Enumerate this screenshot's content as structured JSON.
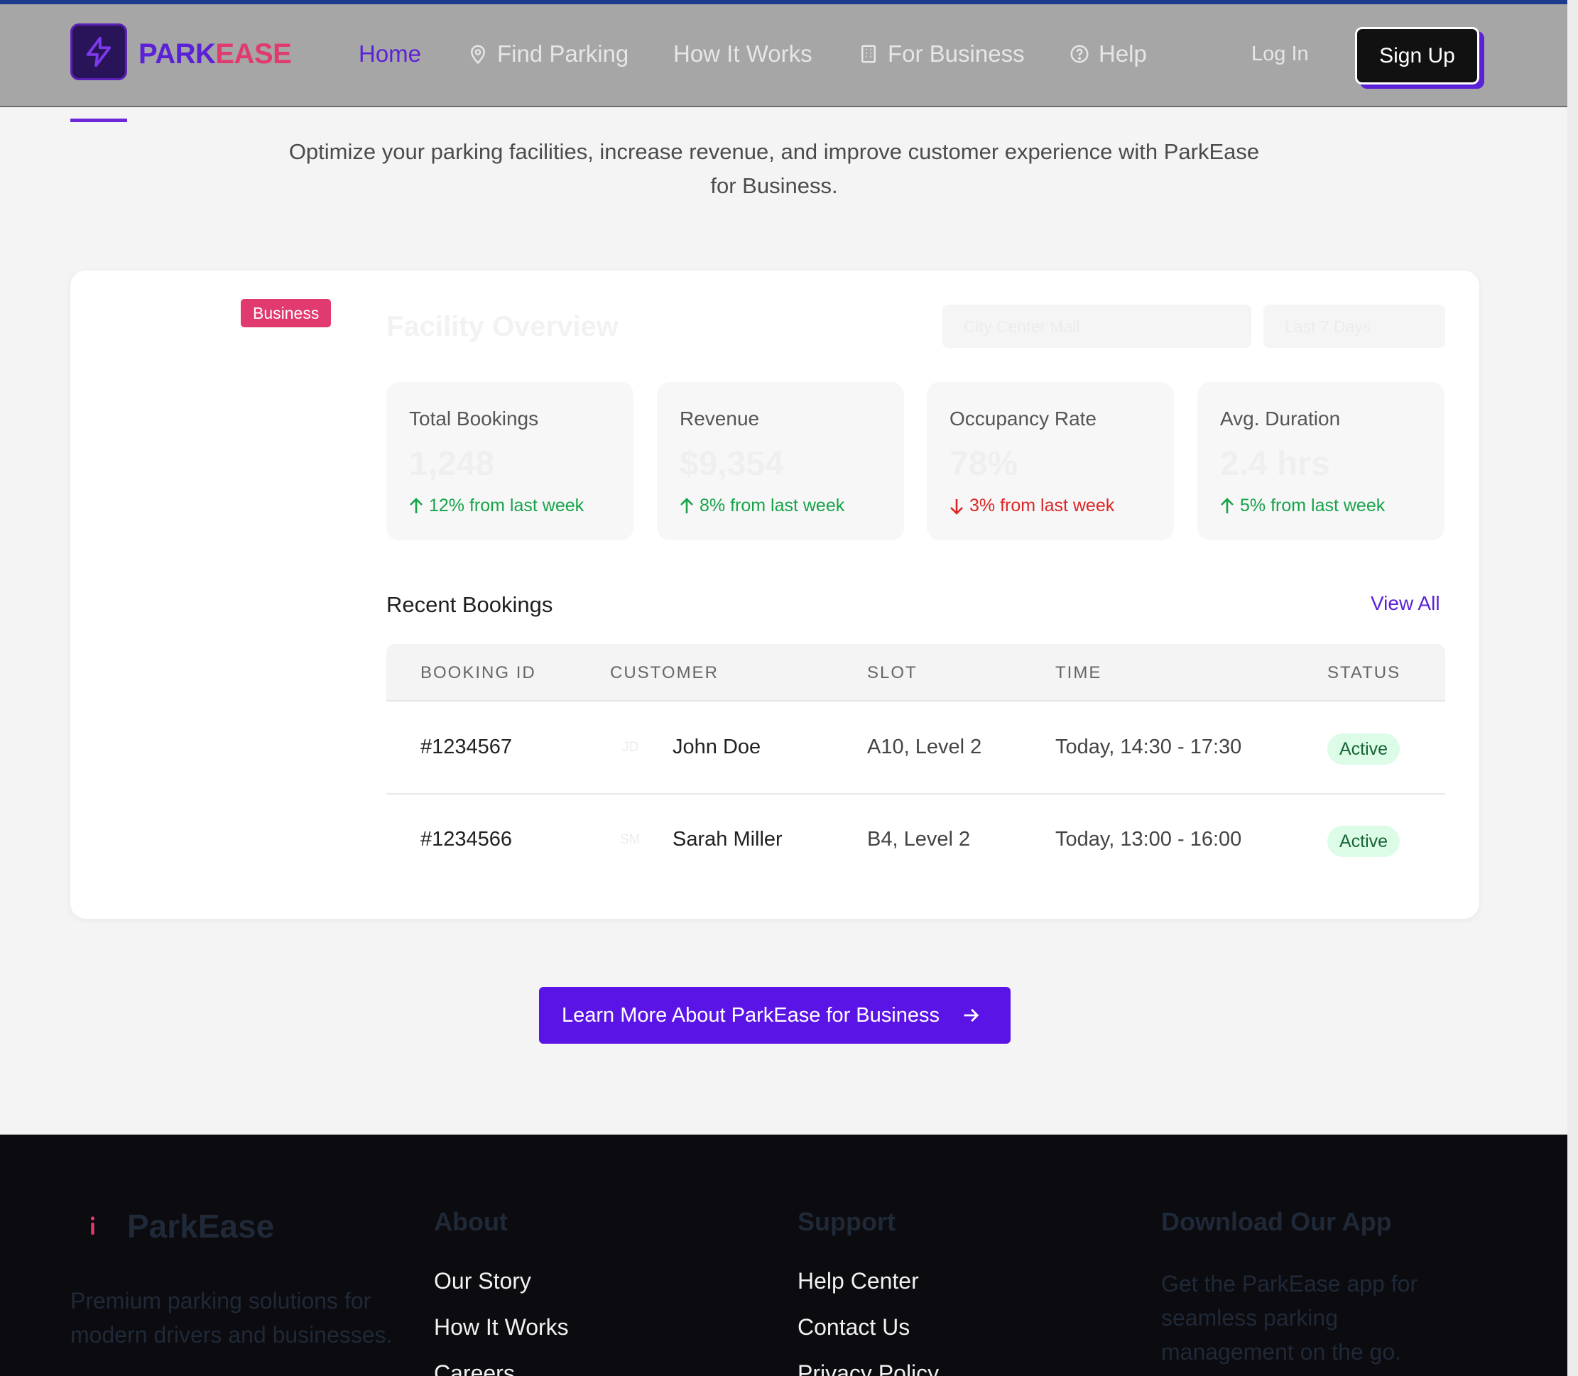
{
  "header": {
    "brand_part1": "PARK",
    "brand_part2": "EASE",
    "nav": [
      {
        "label": "Home"
      },
      {
        "label": "Find Parking"
      },
      {
        "label": "How It Works"
      },
      {
        "label": "For Business"
      },
      {
        "label": "Help"
      }
    ],
    "login": "Log In",
    "signup": "Sign Up"
  },
  "intro": "Optimize your parking facilities, increase revenue, and improve customer experience with ParkEase for Business.",
  "dashboard": {
    "badge": "Business",
    "title": "Facility Overview",
    "facility_select": "City Center Mall",
    "range_select": "Last 7 Days",
    "stats": [
      {
        "label": "Total Bookings",
        "value": "1,248",
        "delta": "12% from last week",
        "trend": "up"
      },
      {
        "label": "Revenue",
        "value": "$9,354",
        "delta": "8% from last week",
        "trend": "up"
      },
      {
        "label": "Occupancy Rate",
        "value": "78%",
        "delta": "3% from last week",
        "trend": "down"
      },
      {
        "label": "Avg. Duration",
        "value": "2.4 hrs",
        "delta": "5% from last week",
        "trend": "up"
      }
    ],
    "recent_title": "Recent Bookings",
    "view_all": "View All",
    "columns": [
      "BOOKING ID",
      "CUSTOMER",
      "SLOT",
      "TIME",
      "STATUS"
    ],
    "rows": [
      {
        "id": "#1234567",
        "initials": "JD",
        "customer": "John Doe",
        "slot": "A10, Level 2",
        "time": "Today, 14:30 - 17:30",
        "status": "Active"
      },
      {
        "id": "#1234566",
        "initials": "SM",
        "customer": "Sarah Miller",
        "slot": "B4, Level 2",
        "time": "Today, 13:00 - 16:00",
        "status": "Active"
      }
    ]
  },
  "cta": "Learn More About ParkEase for Business",
  "footer": {
    "brand": "ParkEase",
    "description": "Premium parking solutions for modern drivers and businesses.",
    "about_title": "About",
    "about_links": [
      "Our Story",
      "How It Works",
      "Careers"
    ],
    "support_title": "Support",
    "support_links": [
      "Help Center",
      "Contact Us",
      "Privacy Policy"
    ],
    "app_title": "Download Our App",
    "app_text": "Get the ParkEase app for seamless parking management on the go."
  },
  "colors": {
    "accent": "#5b21d6",
    "brand_pink": "#e03a6e",
    "up": "#16a34a",
    "down": "#dc2626"
  },
  "icons": [
    "lightning-icon",
    "map-pin-icon",
    "building-icon",
    "help-circle-icon",
    "arrow-up-icon",
    "arrow-down-icon",
    "arrow-right-icon"
  ]
}
